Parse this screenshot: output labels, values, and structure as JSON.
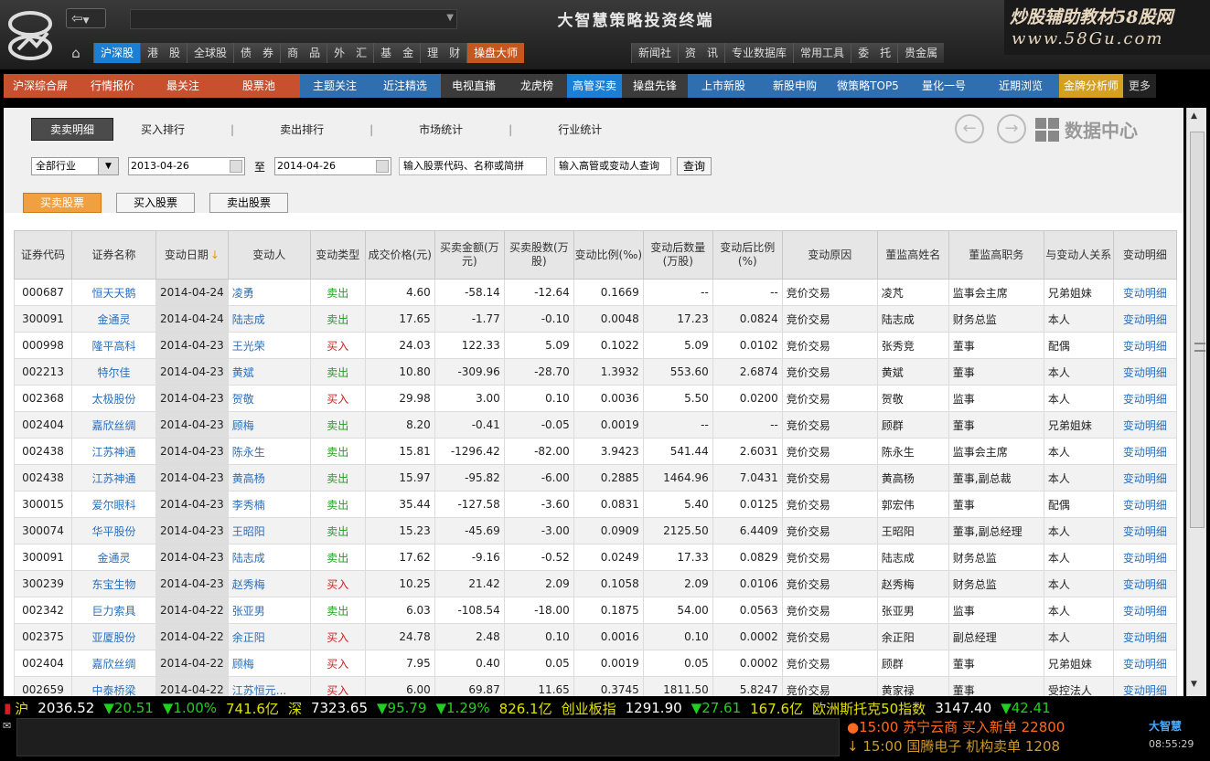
{
  "app": {
    "title": "大智慧策略投资终端"
  },
  "watermark": {
    "line1": "炒股辅助教材58股网",
    "line2": "www.58Gu.com"
  },
  "main_nav": [
    {
      "label": "沪深股",
      "active": true
    },
    {
      "label": "港　股"
    },
    {
      "label": "全球股"
    },
    {
      "label": "债　券"
    },
    {
      "label": "商　品"
    },
    {
      "label": "外　汇"
    },
    {
      "label": "基　金"
    },
    {
      "label": "理　财"
    },
    {
      "label": "操盘大师",
      "orange": true
    }
  ],
  "right_nav": [
    {
      "label": "新闻社"
    },
    {
      "label": "资　讯"
    },
    {
      "label": "专业数据库"
    },
    {
      "label": "常用工具"
    },
    {
      "label": "委　托"
    },
    {
      "label": "贵金属"
    }
  ],
  "sub_nav": [
    {
      "label": "沪深综合屏",
      "style": "red",
      "w": 80
    },
    {
      "label": "行情报价",
      "style": "red",
      "w": 78
    },
    {
      "label": "最关注",
      "style": "red",
      "w": 76
    },
    {
      "label": "股票池",
      "style": "red",
      "w": 90
    },
    {
      "label": "主题关注",
      "style": "blue",
      "w": 76
    },
    {
      "label": "近注精选",
      "style": "blue",
      "w": 78
    },
    {
      "label": "电视直播",
      "style": "grey",
      "w": 72
    },
    {
      "label": "龙虎榜",
      "style": "grey",
      "w": 66
    },
    {
      "label": "高管买卖",
      "style": "cur",
      "w": 60
    },
    {
      "label": "操盘先锋",
      "style": "grey",
      "w": 72
    },
    {
      "label": "上市新股",
      "style": "blue",
      "w": 78
    },
    {
      "label": "新股申购",
      "style": "blue",
      "w": 78
    },
    {
      "label": "微策略TOP5",
      "style": "blue",
      "w": 82
    },
    {
      "label": "量化一号",
      "style": "blue",
      "w": 84
    },
    {
      "label": "近期浏览",
      "style": "blue",
      "w": 84
    },
    {
      "label": "金牌分析师",
      "style": "gold",
      "w": 70
    },
    {
      "label": "更多",
      "style": "more",
      "w": 36
    }
  ],
  "tabs": [
    "卖卖明细",
    "买入排行",
    "卖出排行",
    "市场统计",
    "行业统计"
  ],
  "data_center": "数据中心",
  "filter": {
    "industry": "全部行业",
    "date_from": "2013-04-26",
    "to_label": "至",
    "date_to": "2014-04-26",
    "stock_placeholder": "输入股票代码、名称或简拼",
    "exec_placeholder": "输入高管或变动人查询",
    "query": "查询"
  },
  "sub_buttons": [
    "买卖股票",
    "买入股票",
    "卖出股票"
  ],
  "columns": [
    "证券代码",
    "证券名称",
    "变动日期",
    "变动人",
    "变动类型",
    "成交价格(元)",
    "买卖金额(万元)",
    "买卖股数(万股)",
    "变动比例(‰)",
    "变动后数量(万股)",
    "变动后比例(%)",
    "变动原因",
    "董监高姓名",
    "董监高职务",
    "与变动人关系",
    "变动明细"
  ],
  "rows": [
    [
      "000687",
      "恒天天鹅",
      "2014-04-24",
      "凌勇",
      "卖出",
      "4.60",
      "-58.14",
      "-12.64",
      "0.1669",
      "--",
      "--",
      "竞价交易",
      "凌芃",
      "监事会主席",
      "兄弟姐妹",
      "变动明细"
    ],
    [
      "300091",
      "金通灵",
      "2014-04-24",
      "陆志成",
      "卖出",
      "17.65",
      "-1.77",
      "-0.10",
      "0.0048",
      "17.23",
      "0.0824",
      "竞价交易",
      "陆志成",
      "财务总监",
      "本人",
      "变动明细"
    ],
    [
      "000998",
      "隆平高科",
      "2014-04-23",
      "王光荣",
      "买入",
      "24.03",
      "122.33",
      "5.09",
      "0.1022",
      "5.09",
      "0.0102",
      "竞价交易",
      "张秀竞",
      "董事",
      "配偶",
      "变动明细"
    ],
    [
      "002213",
      "特尔佳",
      "2014-04-23",
      "黄斌",
      "卖出",
      "10.80",
      "-309.96",
      "-28.70",
      "1.3932",
      "553.60",
      "2.6874",
      "竞价交易",
      "黄斌",
      "董事",
      "本人",
      "变动明细"
    ],
    [
      "002368",
      "太极股份",
      "2014-04-23",
      "贺敬",
      "买入",
      "29.98",
      "3.00",
      "0.10",
      "0.0036",
      "5.50",
      "0.0200",
      "竞价交易",
      "贺敬",
      "监事",
      "本人",
      "变动明细"
    ],
    [
      "002404",
      "嘉欣丝绸",
      "2014-04-23",
      "顾梅",
      "卖出",
      "8.20",
      "-0.41",
      "-0.05",
      "0.0019",
      "--",
      "--",
      "竞价交易",
      "顾群",
      "董事",
      "兄弟姐妹",
      "变动明细"
    ],
    [
      "002438",
      "江苏神通",
      "2014-04-23",
      "陈永生",
      "卖出",
      "15.81",
      "-1296.42",
      "-82.00",
      "3.9423",
      "541.44",
      "2.6031",
      "竞价交易",
      "陈永生",
      "监事会主席",
      "本人",
      "变动明细"
    ],
    [
      "002438",
      "江苏神通",
      "2014-04-23",
      "黄高杨",
      "卖出",
      "15.97",
      "-95.82",
      "-6.00",
      "0.2885",
      "1464.96",
      "7.0431",
      "竞价交易",
      "黄高杨",
      "董事,副总裁",
      "本人",
      "变动明细"
    ],
    [
      "300015",
      "爱尔眼科",
      "2014-04-23",
      "李秀楠",
      "卖出",
      "35.44",
      "-127.58",
      "-3.60",
      "0.0831",
      "5.40",
      "0.0125",
      "竞价交易",
      "郭宏伟",
      "董事",
      "配偶",
      "变动明细"
    ],
    [
      "300074",
      "华平股份",
      "2014-04-23",
      "王昭阳",
      "卖出",
      "15.23",
      "-45.69",
      "-3.00",
      "0.0909",
      "2125.50",
      "6.4409",
      "竞价交易",
      "王昭阳",
      "董事,副总经理",
      "本人",
      "变动明细"
    ],
    [
      "300091",
      "金通灵",
      "2014-04-23",
      "陆志成",
      "卖出",
      "17.62",
      "-9.16",
      "-0.52",
      "0.0249",
      "17.33",
      "0.0829",
      "竞价交易",
      "陆志成",
      "财务总监",
      "本人",
      "变动明细"
    ],
    [
      "300239",
      "东宝生物",
      "2014-04-23",
      "赵秀梅",
      "买入",
      "10.25",
      "21.42",
      "2.09",
      "0.1058",
      "2.09",
      "0.0106",
      "竞价交易",
      "赵秀梅",
      "财务总监",
      "本人",
      "变动明细"
    ],
    [
      "002342",
      "巨力索具",
      "2014-04-22",
      "张亚男",
      "卖出",
      "6.03",
      "-108.54",
      "-18.00",
      "0.1875",
      "54.00",
      "0.0563",
      "竞价交易",
      "张亚男",
      "监事",
      "本人",
      "变动明细"
    ],
    [
      "002375",
      "亚厦股份",
      "2014-04-22",
      "余正阳",
      "买入",
      "24.78",
      "2.48",
      "0.10",
      "0.0016",
      "0.10",
      "0.0002",
      "竞价交易",
      "余正阳",
      "副总经理",
      "本人",
      "变动明细"
    ],
    [
      "002404",
      "嘉欣丝绸",
      "2014-04-22",
      "顾梅",
      "买入",
      "7.95",
      "0.40",
      "0.05",
      "0.0019",
      "0.05",
      "0.0002",
      "竞价交易",
      "顾群",
      "董事",
      "兄弟姐妹",
      "变动明细"
    ],
    [
      "002659",
      "中泰桥梁",
      "2014-04-22",
      "江苏恒元...",
      "买入",
      "6.00",
      "69.87",
      "11.65",
      "0.3745",
      "1811.50",
      "5.8247",
      "竞价交易",
      "黄家禄",
      "董事",
      "受控法人",
      "变动明细"
    ]
  ],
  "ticker": [
    {
      "t": "沪",
      "c": "ty"
    },
    {
      "t": "2036.52",
      "c": "tw"
    },
    {
      "t": "▼20.51",
      "c": "tg"
    },
    {
      "t": "▼1.00%",
      "c": "tg"
    },
    {
      "t": "741.6亿",
      "c": "ty"
    },
    {
      "t": "深",
      "c": "ty"
    },
    {
      "t": "7323.65",
      "c": "tw"
    },
    {
      "t": "▼95.79",
      "c": "tg"
    },
    {
      "t": "▼1.29%",
      "c": "tg"
    },
    {
      "t": "826.1亿",
      "c": "ty"
    },
    {
      "t": "创业板指",
      "c": "ty"
    },
    {
      "t": "1291.90",
      "c": "tw"
    },
    {
      "t": "▼27.61",
      "c": "tg"
    },
    {
      "t": "167.6亿",
      "c": "ty"
    },
    {
      "t": "欧洲斯托克50指数",
      "c": "ty"
    },
    {
      "t": "3147.40",
      "c": "tw"
    },
    {
      "t": "▼42.41",
      "c": "tg"
    }
  ],
  "news": [
    "●15:00 苏宁云商 买入新单 22800",
    "↓ 15:00 国腾电子 机构卖单 1208"
  ],
  "brand": "大智慧",
  "clock": "08:55:29"
}
